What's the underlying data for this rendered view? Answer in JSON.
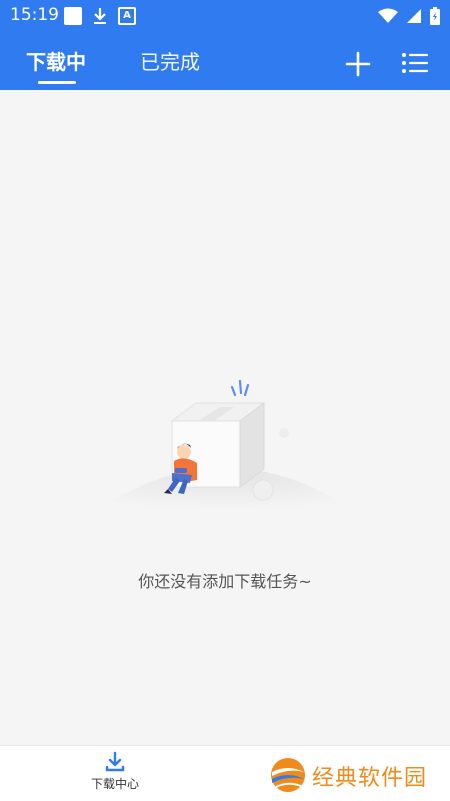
{
  "status_bar": {
    "time": "15:19",
    "badge_letter": "A",
    "icons": [
      "notification-square-icon",
      "download-icon",
      "a-badge-icon",
      "wifi-icon",
      "signal-icon",
      "battery-icon"
    ]
  },
  "tabs": [
    {
      "label": "下载中",
      "active": true
    },
    {
      "label": "已完成",
      "active": false
    }
  ],
  "toolbar": {
    "add_icon": "plus-icon",
    "menu_icon": "list-menu-icon"
  },
  "empty_state": {
    "message": "你还没有添加下载任务~"
  },
  "bottom_nav": {
    "items": [
      {
        "label": "下载中心",
        "icon": "download-icon",
        "active": true
      }
    ]
  },
  "watermark": {
    "text": "经典软件园"
  },
  "colors": {
    "primary": "#2f7bef",
    "background": "#f5f5f5",
    "watermark": "#f08a1a"
  }
}
